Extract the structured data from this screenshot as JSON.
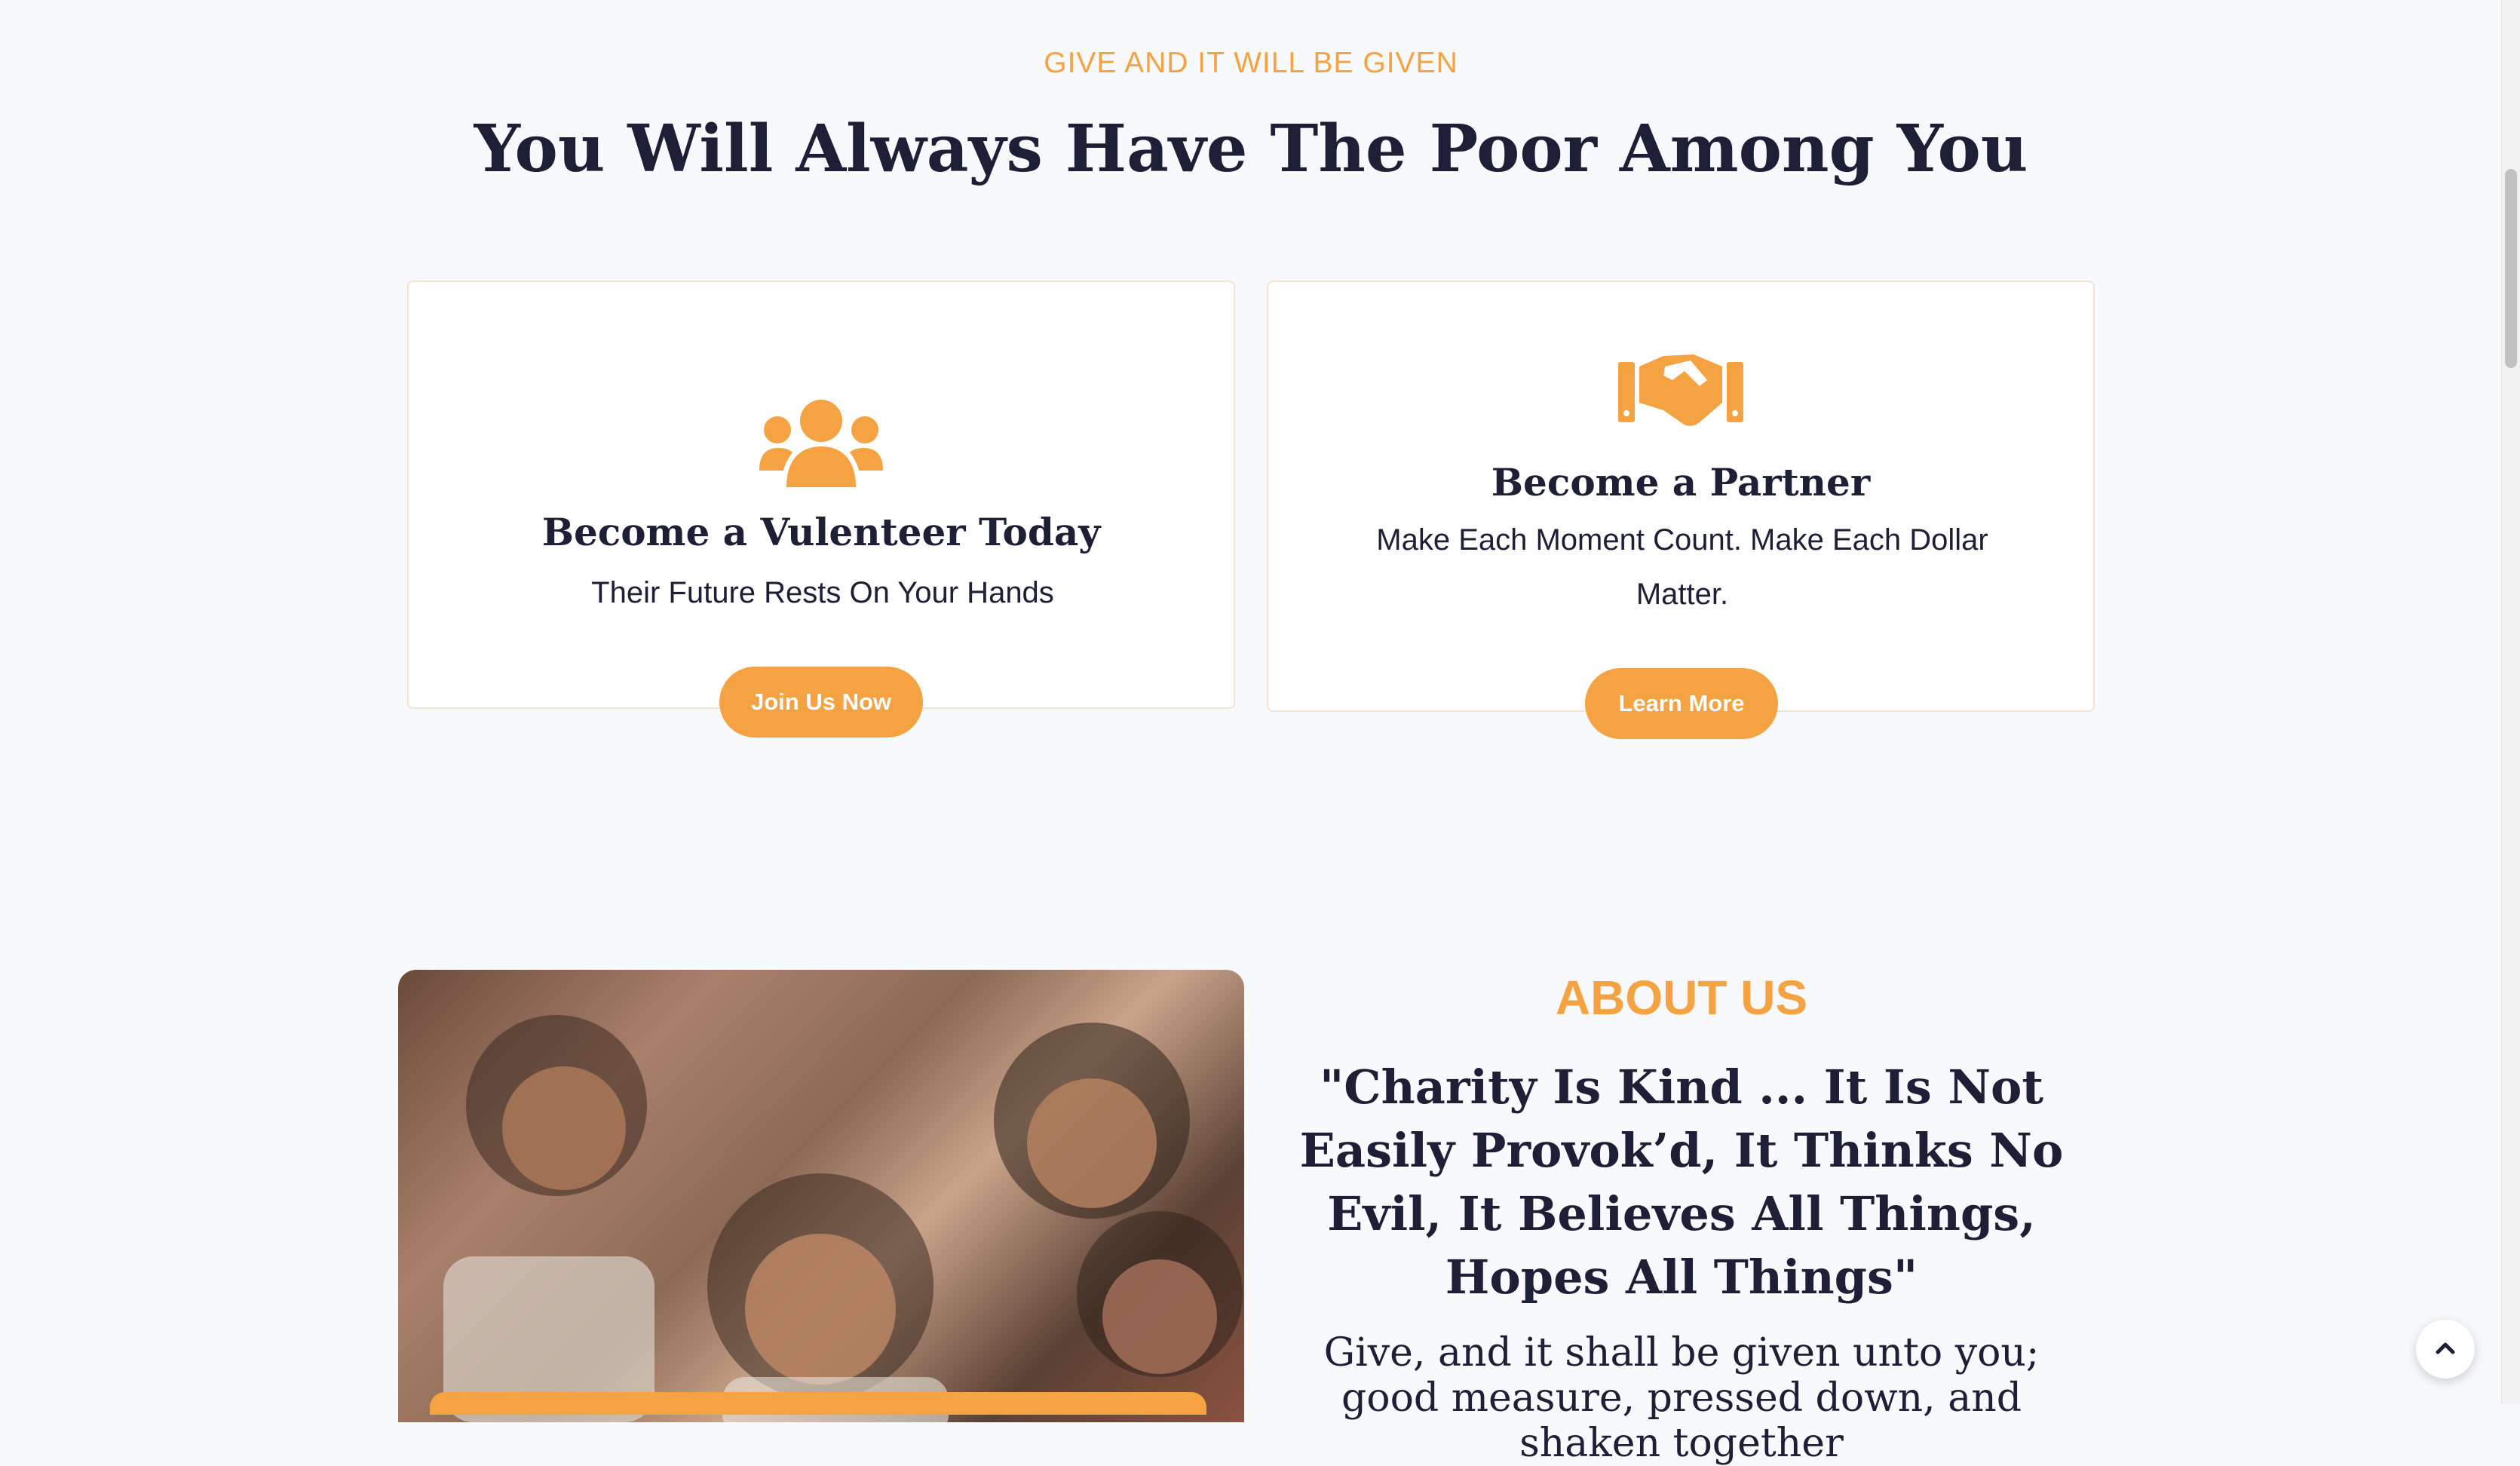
{
  "section": {
    "eyebrow": "GIVE AND IT WILL BE GIVEN",
    "title": "You Will Always Have The Poor Among You"
  },
  "cards": [
    {
      "icon": "users-group-icon",
      "title": "Become a Vulenteer Today",
      "text": "Their Future Rests On Your Hands",
      "button": "Join Us Now"
    },
    {
      "icon": "handshake-icon",
      "title": "Become a Partner",
      "text": "Make Each Moment Count. Make Each Dollar Matter.",
      "button": "Learn More"
    }
  ],
  "about": {
    "label": "ABOUT US",
    "quote": "\"Charity Is Kind ... It Is Not Easily Provok’d, It Thinks No Evil, It Believes All Things, Hopes All Things\"",
    "body": "Give, and it shall be given unto you; good measure, pressed down, and shaken together"
  },
  "photo": {
    "subject": "children-photo"
  },
  "colors": {
    "accent": "#f4a242",
    "heading": "#1c1f35",
    "background": "#f8f9fd"
  },
  "scroll_top_icon": "chevron-up-icon"
}
